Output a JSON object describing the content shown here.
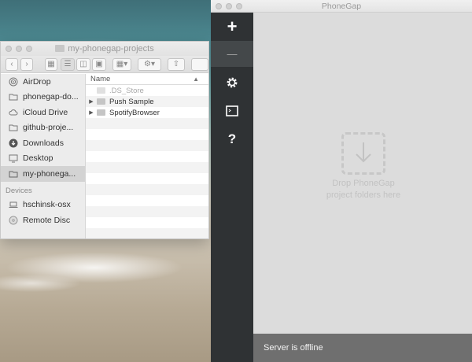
{
  "finder": {
    "title": "my-phonegap-projects",
    "sidebar": {
      "items": [
        {
          "label": "AirDrop",
          "icon": "airdrop-icon"
        },
        {
          "label": "phonegap-do...",
          "icon": "folder-icon"
        },
        {
          "label": "iCloud Drive",
          "icon": "cloud-icon"
        },
        {
          "label": "github-proje...",
          "icon": "folder-icon"
        },
        {
          "label": "Downloads",
          "icon": "download-icon"
        },
        {
          "label": "Desktop",
          "icon": "desktop-icon"
        },
        {
          "label": "my-phonega...",
          "icon": "folder-icon",
          "selected": true
        }
      ],
      "devices_heading": "Devices",
      "devices": [
        {
          "label": "hschinsk-osx",
          "icon": "laptop-icon"
        },
        {
          "label": "Remote Disc",
          "icon": "disc-icon"
        }
      ]
    },
    "column_header": "Name",
    "files": [
      {
        "name": ".DS_Store",
        "hidden": true
      },
      {
        "name": "Push Sample"
      },
      {
        "name": "SpotifyBrowser"
      }
    ]
  },
  "phonegap": {
    "title": "PhoneGap",
    "rail": {
      "add": "+",
      "remove": "—",
      "settings": "settings-icon",
      "terminal": "terminal-icon",
      "help": "?"
    },
    "drop_line1": "Drop PhoneGap",
    "drop_line2": "project folders here",
    "status": "Server is offline"
  },
  "colors": {
    "rail": "#2f3234",
    "rail_selected": "#44484a",
    "content": "#dcdcdc",
    "statusbar": "#6f6f6f"
  }
}
